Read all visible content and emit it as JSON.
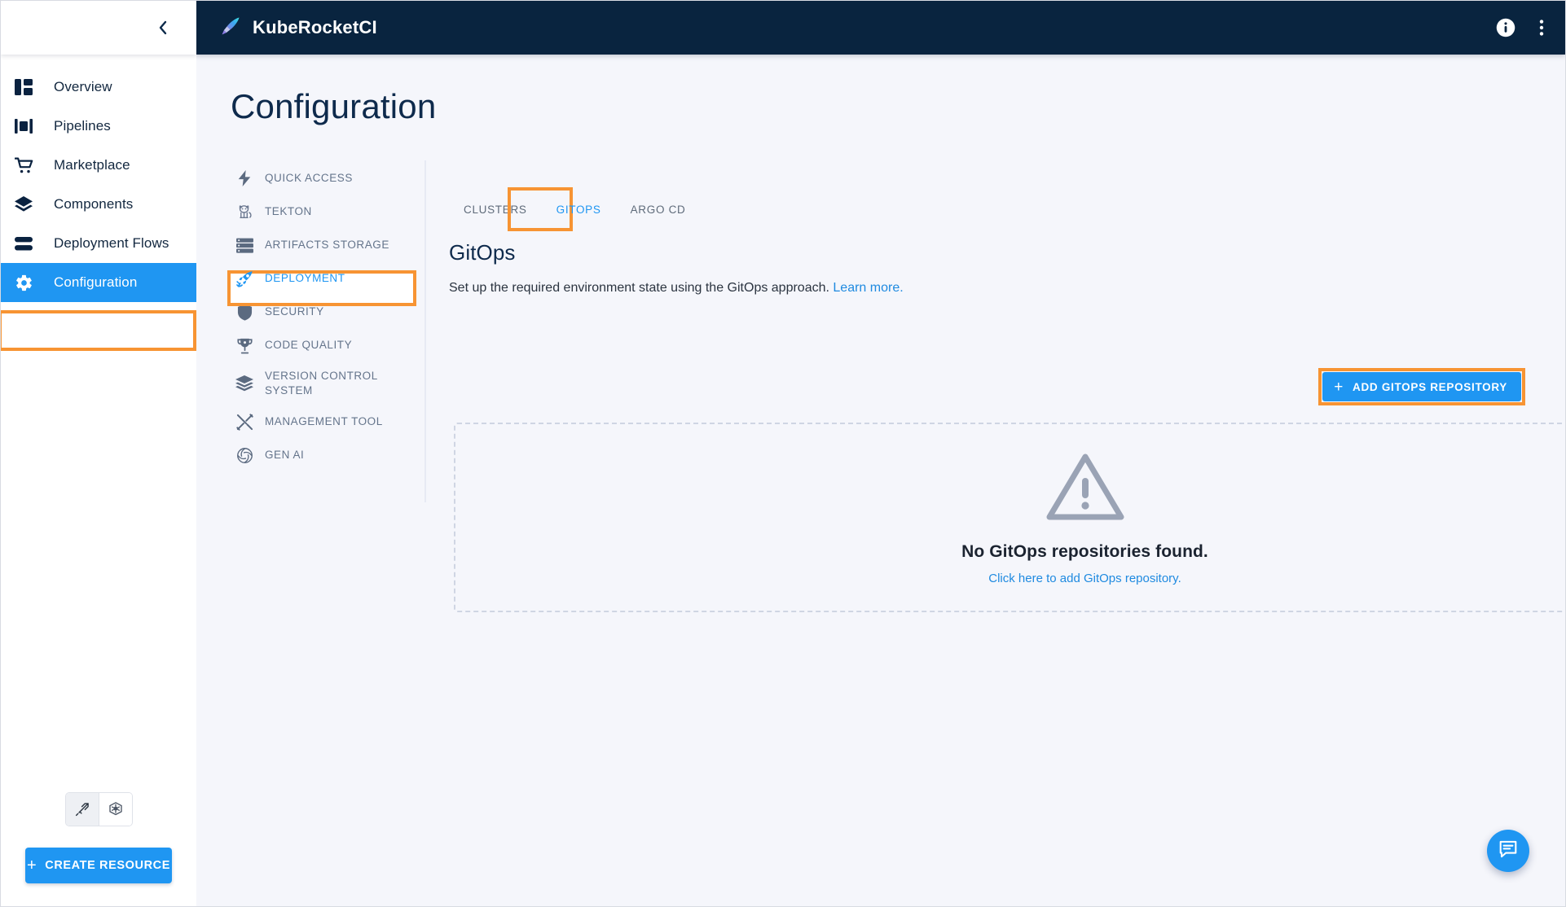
{
  "app": {
    "brand": "KubeRocketCI",
    "brand_icon": "rocket-pen-logo",
    "accent_blue": "#1f96f2",
    "header_bg": "#09243f",
    "highlight_orange": "#f79433",
    "page_bg": "#f5f6fb"
  },
  "topbar": {
    "info_icon": "info-icon",
    "more_icon": "more-vertical-icon"
  },
  "sidebar": {
    "collapse_icon": "chevron-left-icon",
    "items": [
      {
        "label": "Overview",
        "icon": "dashboard-icon",
        "active": false
      },
      {
        "label": "Pipelines",
        "icon": "pipelines-icon",
        "active": false
      },
      {
        "label": "Marketplace",
        "icon": "cart-icon",
        "active": false
      },
      {
        "label": "Components",
        "icon": "layers-icon",
        "active": false
      },
      {
        "label": "Deployment Flows",
        "icon": "stack-icon",
        "active": false
      },
      {
        "label": "Configuration",
        "icon": "gear-icon",
        "active": true
      }
    ],
    "theme_toggles": [
      {
        "icon": "krci-sword-icon",
        "selected": true
      },
      {
        "icon": "kubernetes-icon",
        "selected": false
      }
    ],
    "create_button": {
      "label": "CREATE RESOURCE",
      "plus": "+"
    }
  },
  "page": {
    "title": "Configuration"
  },
  "config_nav": {
    "items": [
      {
        "label": "QUICK ACCESS",
        "icon": "lightning-icon",
        "active": false
      },
      {
        "label": "TEKTON",
        "icon": "tekton-cat-icon",
        "active": false
      },
      {
        "label": "ARTIFACTS STORAGE",
        "icon": "storage-icon",
        "active": false
      },
      {
        "label": "DEPLOYMENT",
        "icon": "rocket-icon",
        "active": true
      },
      {
        "label": "SECURITY",
        "icon": "shield-icon",
        "active": false
      },
      {
        "label": "CODE QUALITY",
        "icon": "trophy-icon",
        "active": false
      },
      {
        "label": "VERSION CONTROL SYSTEM",
        "icon": "layers-icon",
        "active": false
      },
      {
        "label": "MANAGEMENT TOOL",
        "icon": "tools-icon",
        "active": false
      },
      {
        "label": "GEN AI",
        "icon": "openai-icon",
        "active": false
      }
    ]
  },
  "tabs": [
    {
      "label": "CLUSTERS",
      "active": false
    },
    {
      "label": "GITOPS",
      "active": true
    },
    {
      "label": "ARGO CD",
      "active": false
    }
  ],
  "content": {
    "section_title": "GitOps",
    "description": "Set up the required environment state using the GitOps approach.",
    "learn_more": "Learn more.",
    "add_button": {
      "label": "ADD GITOPS REPOSITORY",
      "plus": "+"
    },
    "empty_state": {
      "icon": "warning-triangle-icon",
      "title": "No GitOps repositories found.",
      "link": "Click here to add GitOps repository."
    }
  },
  "chat": {
    "icon": "chat-bubble-icon"
  }
}
